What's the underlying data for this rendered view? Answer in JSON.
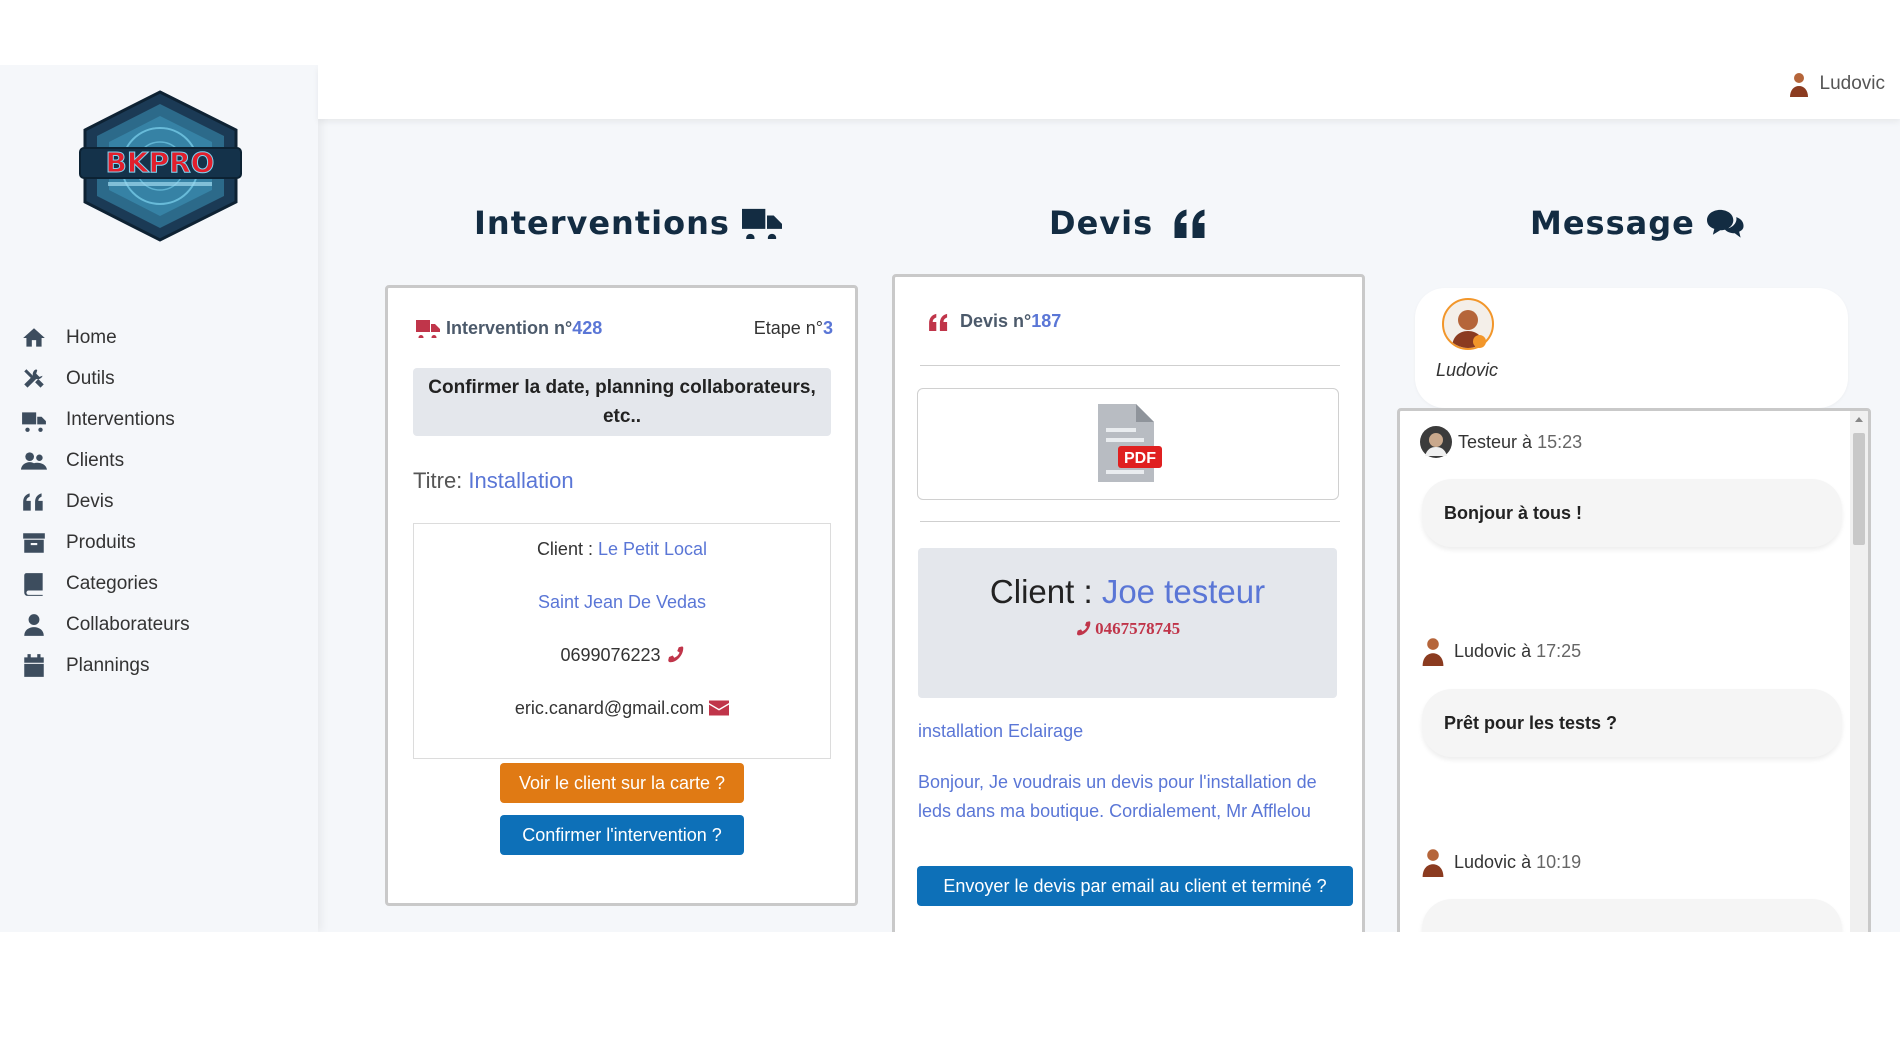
{
  "header": {
    "user_name": "Ludovic"
  },
  "sidebar": {
    "logo_text": "BKPRO",
    "items": [
      {
        "label": "Home",
        "icon": "home-icon"
      },
      {
        "label": "Outils",
        "icon": "tools-icon"
      },
      {
        "label": "Interventions",
        "icon": "truck-icon"
      },
      {
        "label": "Clients",
        "icon": "users-icon"
      },
      {
        "label": "Devis",
        "icon": "quote-icon"
      },
      {
        "label": "Produits",
        "icon": "archive-icon"
      },
      {
        "label": "Categories",
        "icon": "book-icon"
      },
      {
        "label": "Collaborateurs",
        "icon": "user-icon"
      },
      {
        "label": "Plannings",
        "icon": "calendar-icon"
      }
    ]
  },
  "interventions": {
    "title": "Interventions",
    "label": "Intervention n°",
    "number": "428",
    "step_label": "Etape n°",
    "step_number": "3",
    "confirm_text": "Confirmer la date, planning collaborateurs, etc..",
    "titre_label": "Titre:",
    "titre_value": "Installation",
    "client_label": "Client :",
    "client_name": "Le Petit Local",
    "city": "Saint Jean De Vedas",
    "phone": "0699076223",
    "email": "eric.canard@gmail.com",
    "btn_map": "Voir le client sur la carte ?",
    "btn_confirm": "Confirmer l'intervention ?"
  },
  "devis": {
    "title": "Devis",
    "label": "Devis n°",
    "number": "187",
    "pdf_label": "PDF",
    "client_label": "Client :",
    "client_name": "Joe testeur",
    "phone": "0467578745",
    "subject": "installation Eclairage",
    "description": "Bonjour, Je voudrais un devis pour l'installation de leds dans ma boutique. Cordialement, Mr Afflelou",
    "btn_send": "Envoyer le devis par email au client et terminé ?"
  },
  "message": {
    "title": "Message",
    "contact_name": "Ludovic",
    "messages": [
      {
        "author": "Testeur",
        "sep": "à",
        "time": "15:23",
        "text": "Bonjour à tous !"
      },
      {
        "author": "Ludovic",
        "sep": "à",
        "time": "17:25",
        "text": "Prêt pour les tests ?"
      },
      {
        "author": "Ludovic",
        "sep": "à",
        "time": "10:19",
        "text": ""
      }
    ]
  },
  "colors": {
    "accent": "#5a76d6",
    "title": "#132c42",
    "orange_button": "#e07a14",
    "blue_button": "#0d70b8",
    "red_icon": "#c0354a"
  }
}
